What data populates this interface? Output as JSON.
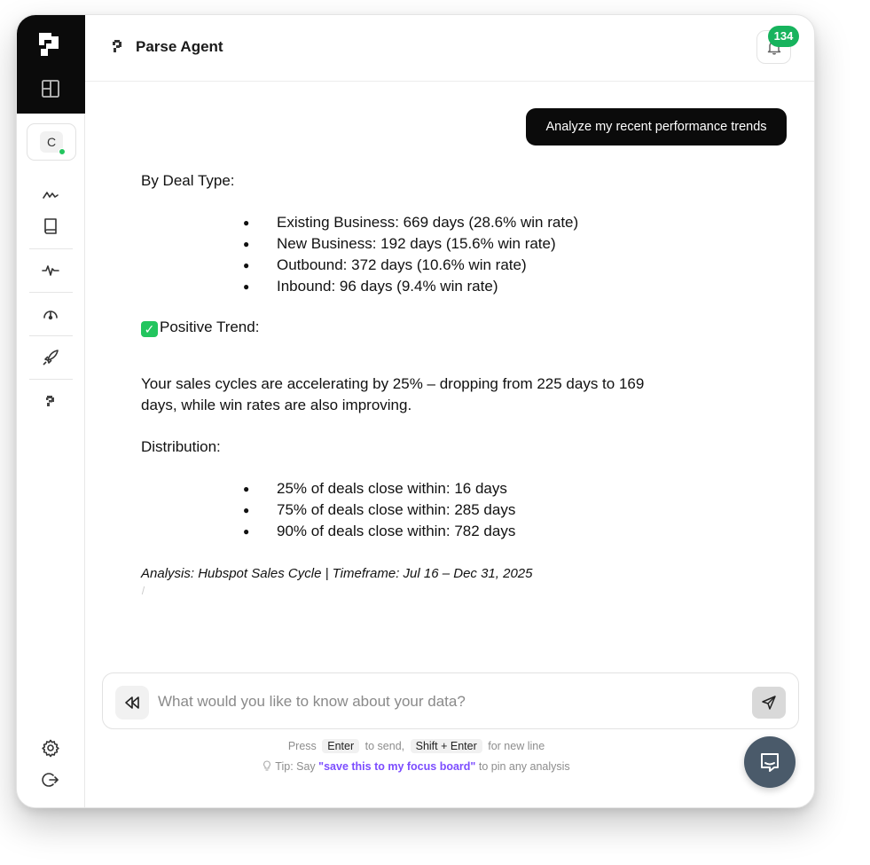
{
  "app": {
    "title": "Parse Agent",
    "notification_count": "134"
  },
  "sidebar": {
    "user_initial": "C",
    "items": [
      {
        "name": "activity",
        "icon": "activity-icon"
      },
      {
        "name": "book",
        "icon": "book-icon"
      },
      {
        "name": "pulse",
        "icon": "pulse-icon"
      },
      {
        "name": "gauge",
        "icon": "gauge-icon"
      },
      {
        "name": "rocket",
        "icon": "rocket-icon"
      },
      {
        "name": "parse",
        "icon": "parse-logo-icon"
      }
    ],
    "bottom": [
      {
        "name": "settings",
        "icon": "gear-icon"
      },
      {
        "name": "logout",
        "icon": "logout-icon"
      }
    ]
  },
  "chat": {
    "user_message": "Analyze my recent performance trends",
    "response": {
      "deal_type_heading": "By Deal Type:",
      "deal_types": [
        "Existing Business: 669 days (28.6% win rate)",
        "New Business: 192 days (15.6% win rate)",
        "Outbound: 372 days (10.6% win rate)",
        "Inbound: 96 days (9.4% win rate)"
      ],
      "trend_heading": "Positive Trend:",
      "trend_text": "Your sales cycles are accelerating by 25% – dropping from 225 days to 169 days, while win rates are also improving.",
      "distribution_heading": "Distribution:",
      "distribution": [
        "25% of deals close within: 16 days",
        "75% of deals close within: 285 days",
        "90% of deals close within: 782 days"
      ],
      "analysis_note": "Analysis: Hubspot Sales Cycle | Timeframe: Jul 16 – Dec 31, 2025"
    }
  },
  "input": {
    "placeholder": "What would you like to know about your data?",
    "value": ""
  },
  "hints": {
    "press": "Press",
    "enter_key": "Enter",
    "to_send": "to send,",
    "shift_enter_key": "Shift + Enter",
    "for_new_line": "for new line",
    "tip_prefix": "Tip: Say",
    "tip_phrase": "\"save this to my focus board\"",
    "tip_suffix": "to pin any analysis"
  },
  "colors": {
    "accent_dark": "#0b0b0b",
    "badge_green": "#17b35d",
    "tip_purple": "#7c4dff",
    "help_button": "#4a5a6a"
  }
}
